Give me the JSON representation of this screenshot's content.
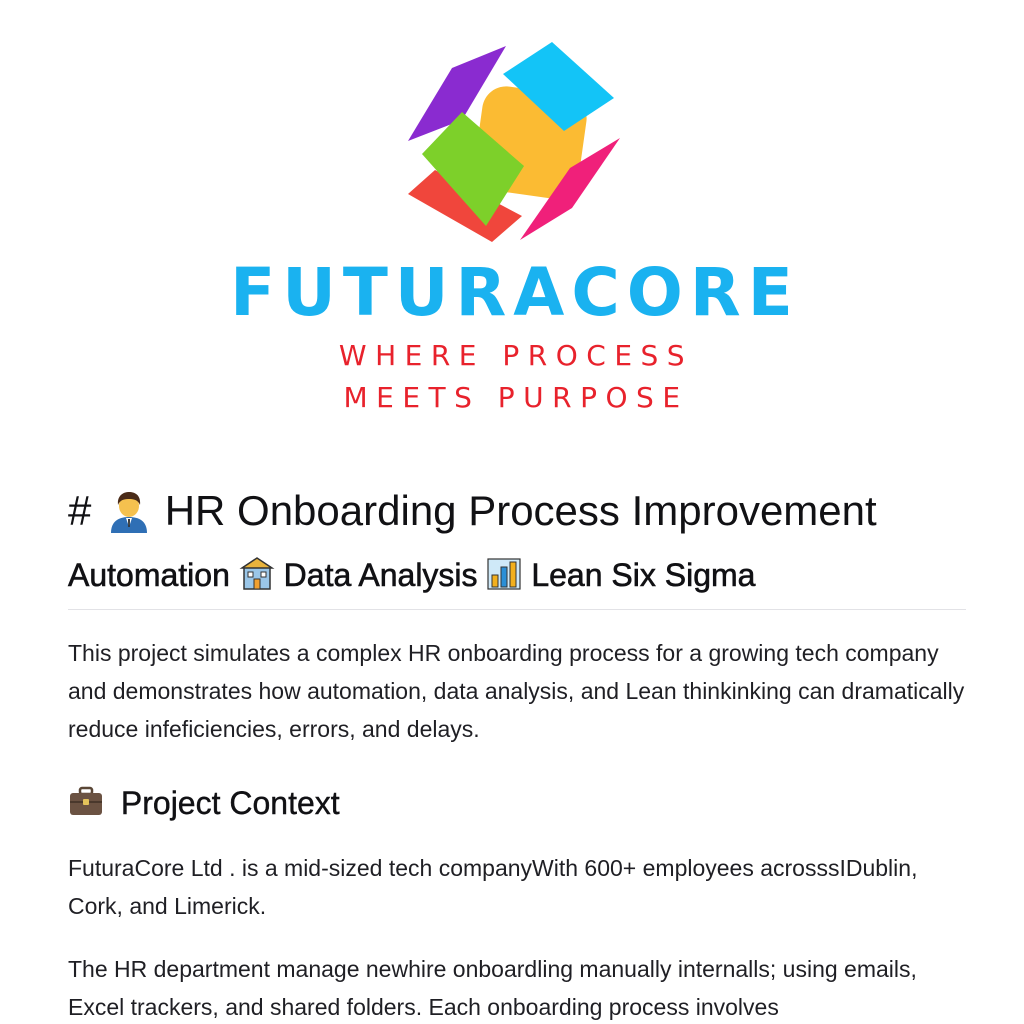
{
  "logo": {
    "wordmark": "FUTURACORE",
    "tagline_line1": "WHERE PROCESS",
    "tagline_line2": "MEETS PURPOSE",
    "colors": {
      "purple": "#8a2bd0",
      "cyan": "#13c4f7",
      "orange": "#fbbb33",
      "green": "#7dd02a",
      "red": "#f0463c",
      "magenta": "#f0207a",
      "wordmark": "#1ab2f0",
      "tagline": "#e8222c"
    }
  },
  "document": {
    "title_hash": "#",
    "title_icon": "person-office-worker-icon",
    "title_text": "HR Onboarding Process Improvement",
    "subtitle_part1": "Automation",
    "subtitle_icon1": "building-icon",
    "subtitle_part2": "Data Analysis",
    "subtitle_icon2": "bar-chart-icon",
    "subtitle_part3": "Lean Six Sigma",
    "intro": "This project simulates a complex HR onboarding process for a growing tech company and demonstrates how automation, data analysis, and Lean thinkinking can dramatically reduce infeficiencies, errors, and delays.",
    "context_icon": "briefcase-icon",
    "context_heading": "Project Context",
    "context_para1": "FuturaCore Ltd . is a mid-sized tech companyWith 600+ employees acrosssIDublin, Cork, and Limerick.",
    "context_para2": "The HR department manage newhire onboardling manually internalls; using emails, Excel trackers, and shared folders. Each onboarding process involves"
  }
}
